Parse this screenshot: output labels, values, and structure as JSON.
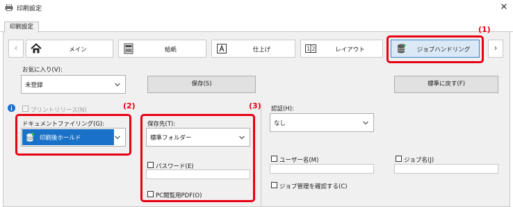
{
  "window": {
    "title": "印刷設定",
    "icon": "printer-icon",
    "close_icon": "close-icon"
  },
  "tabs": [
    {
      "label": "印刷設定",
      "active": true
    }
  ],
  "nav": {
    "prev_arrow": "‹",
    "next_arrow": "›",
    "buttons": [
      {
        "label": "メイン",
        "icon": "home-icon"
      },
      {
        "label": "給紙",
        "icon": "paper-tray-icon"
      },
      {
        "label": "仕上げ",
        "icon": "finishing-icon"
      },
      {
        "label": "レイアウト",
        "icon": "layout-icon"
      },
      {
        "label": "ジョブハンドリング",
        "icon": "job-handling-icon",
        "active": true
      }
    ]
  },
  "callouts": {
    "c1": "(1)",
    "c2": "(2)",
    "c3": "(3)"
  },
  "favorites": {
    "label": "お気に入り(V):",
    "value": "未登録",
    "save_button": "保存(S)",
    "reset_button": "標準に戻す(F)"
  },
  "print_release": {
    "label": "プリントリリース(N)",
    "checked": false,
    "enabled": false,
    "info_icon": "info-icon"
  },
  "document_filing": {
    "label": "ドキュメントファイリング(G):",
    "value": "印刷後ホールド",
    "icon": "document-filing-icon"
  },
  "storage": {
    "label": "保存先(T):",
    "value": "標準フォルダー",
    "password_label": "パスワード(E)",
    "password_value": "",
    "pdf_label": "PC閲覧用PDF(O)"
  },
  "authentication": {
    "label": "認証(H):",
    "value": "なし"
  },
  "user_name": {
    "label": "ユーザー名(M)",
    "value": ""
  },
  "job_name": {
    "label": "ジョブ名(J)",
    "value": ""
  },
  "confirm_job": {
    "label": "ジョブ管理を確認する(C)"
  },
  "colors": {
    "accent_red": "#e60012",
    "selected_blue": "#1a72c8",
    "active_nav_bg": "#dbe9f7"
  }
}
